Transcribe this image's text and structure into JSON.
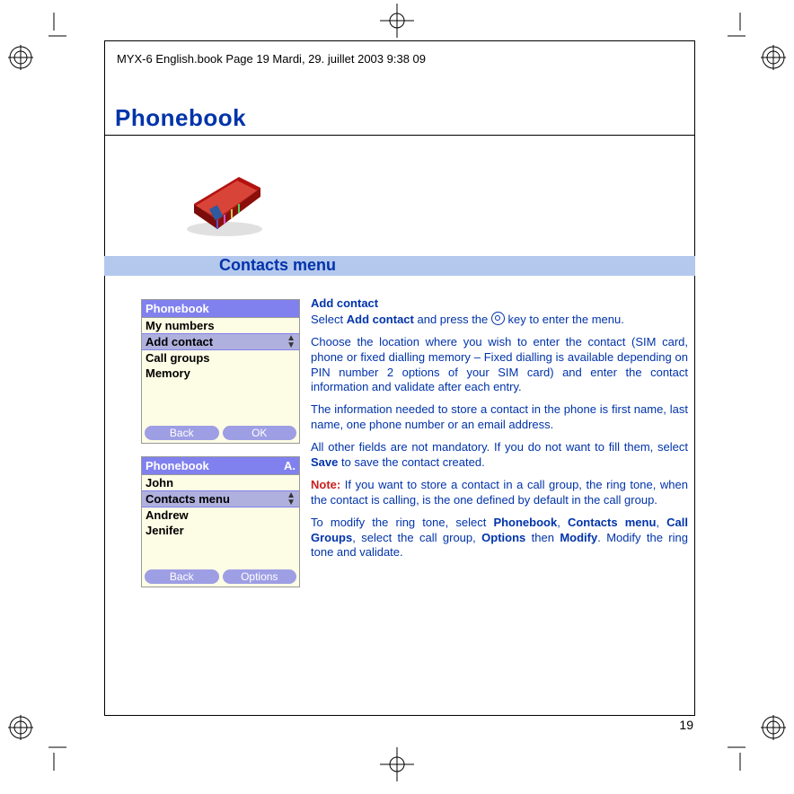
{
  "header_line": "MYX-6 English.book  Page 19  Mardi, 29. juillet 2003  9:38 09",
  "page_title": "Phonebook",
  "section_title": "Contacts menu",
  "page_number": "19",
  "screen1": {
    "title": "Phonebook",
    "items": [
      "My numbers",
      "Add contact",
      "Call groups",
      "Memory"
    ],
    "selected_index": 1,
    "softkeys": {
      "left": "Back",
      "right": "OK"
    }
  },
  "screen2": {
    "title_left": "Phonebook",
    "title_right": "A.",
    "items": [
      "John",
      "Contacts menu",
      "Andrew",
      "Jenifer"
    ],
    "selected_index": 1,
    "softkeys": {
      "left": "Back",
      "right": "Options"
    }
  },
  "body": {
    "h1": "Add contact",
    "p1a": "Select ",
    "p1b": "Add contact",
    "p1c": " and press the ",
    "p1d": " key to enter the menu.",
    "p2": "Choose the location where you wish to enter the contact (SIM card, phone or fixed dialling memory – Fixed dialling is available depending on PIN number 2 options of your SIM card) and enter the contact information and validate after each entry.",
    "p3": "The information needed to store a contact in the phone is first name, last name, one phone number or an email address.",
    "p4a": "All other fields are not mandatory. If you do not want to fill them, select ",
    "p4b": "Save",
    "p4c": " to save the contact created.",
    "note_label": "Note:",
    "p5": " If you want to store a contact in a call group, the ring tone, when the contact is calling, is the one defined by default in the call group.",
    "p6a": "To modify the ring tone, select ",
    "p6b": "Phonebook",
    "p6c": ", ",
    "p6d": "Contacts menu",
    "p6e": ", ",
    "p6f": "Call Groups",
    "p6g": ", select the call group, ",
    "p6h": "Options",
    "p6i": " then ",
    "p6j": "Modify",
    "p6k": ". Modify the ring tone and validate."
  }
}
